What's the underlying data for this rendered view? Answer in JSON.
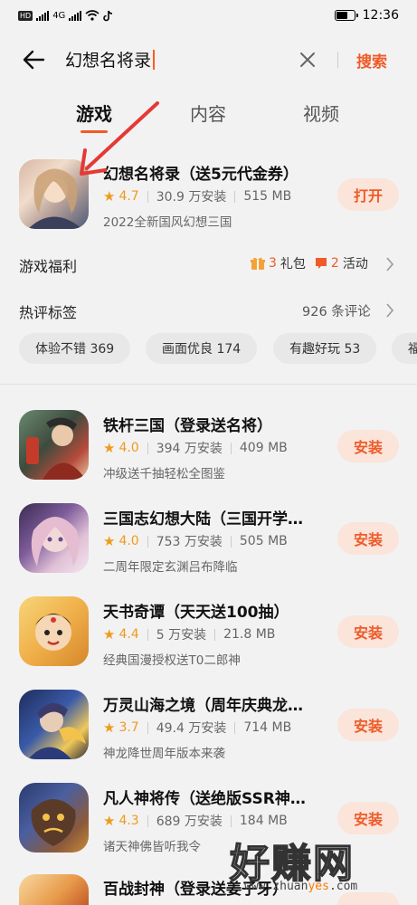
{
  "status_bar": {
    "left_chip": "HD",
    "network": "4G",
    "time": "12:36"
  },
  "search": {
    "query": "幻想名将录",
    "search_button": "搜索"
  },
  "tabs": [
    {
      "label": "游戏",
      "active": true
    },
    {
      "label": "内容",
      "active": false
    },
    {
      "label": "视频",
      "active": false
    }
  ],
  "featured": {
    "title": "幻想名将录（送5元代金券）",
    "rating": "4.7",
    "installs": "30.9 万安装",
    "size": "515 MB",
    "description": "2022全新国风幻想三国",
    "action": "打开"
  },
  "welfare": {
    "label": "游戏福利",
    "gift_count": "3",
    "gift_label": "礼包",
    "activity_count": "2",
    "activity_label": "活动"
  },
  "hot_tags": {
    "label": "热评标签",
    "comments": "926  条评论",
    "tags": [
      "体验不错 369",
      "画面优良 174",
      "有趣好玩 53",
      "福"
    ]
  },
  "apps": [
    {
      "title": "铁杆三国（登录送名将）",
      "rating": "4.0",
      "installs": "394 万安装",
      "size": "409 MB",
      "description": "冲级送千抽轻松全图鉴",
      "action": "安装"
    },
    {
      "title": "三国志幻想大陆（三国开学…",
      "rating": "4.0",
      "installs": "753 万安装",
      "size": "505 MB",
      "description": "二周年限定玄渊吕布降临",
      "action": "安装"
    },
    {
      "title": "天书奇谭（天天送100抽）",
      "rating": "4.4",
      "installs": "5 万安装",
      "size": "21.8 MB",
      "description": "经典国漫授权送T0二郎神",
      "action": "安装"
    },
    {
      "title": "万灵山海之境（周年庆典龙…",
      "rating": "3.7",
      "installs": "49.4 万安装",
      "size": "714 MB",
      "description": "神龙降世周年版本来袭",
      "action": "安装"
    },
    {
      "title": "凡人神将传（送绝版SSR神…",
      "rating": "4.3",
      "installs": "689 万安装",
      "size": "184 MB",
      "description": "诸天神佛皆听我令",
      "action": "安装"
    },
    {
      "title": "百战封神（登录送姜子牙）",
      "rating": "",
      "installs": "",
      "size": "",
      "description": "",
      "action": "安装"
    }
  ],
  "watermark": {
    "big": "好赚网",
    "small_a": "www.zhuan",
    "small_b": "yes",
    "small_c": ".com"
  },
  "colors": {
    "accent": "#f05a28",
    "button_bg": "#fbe4da",
    "star": "#f09a1b"
  }
}
